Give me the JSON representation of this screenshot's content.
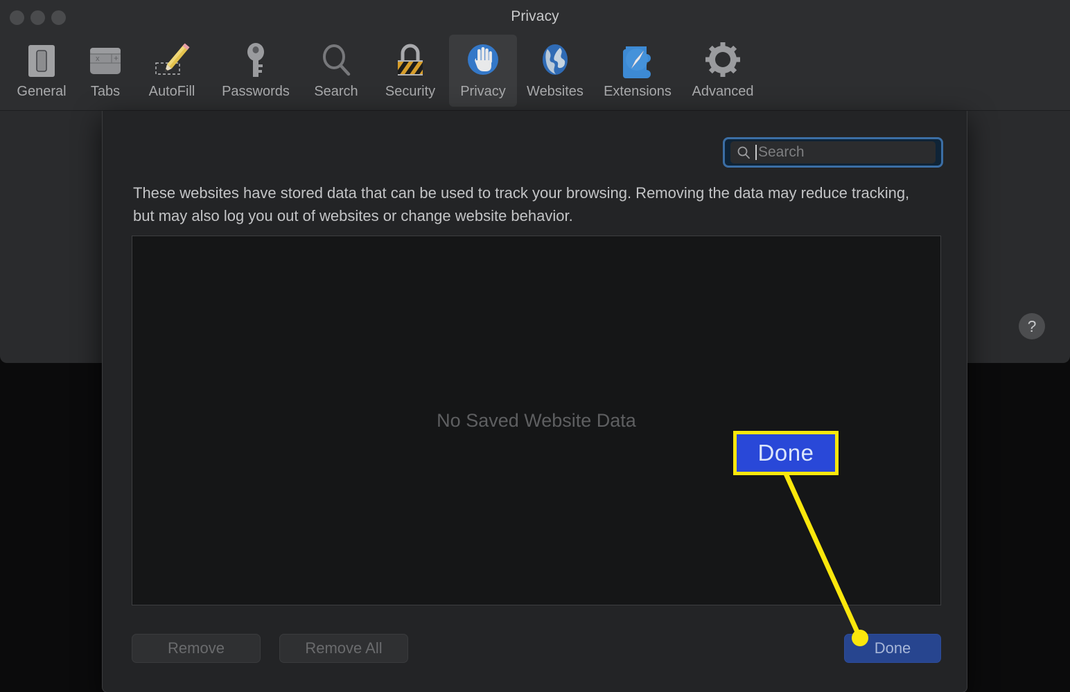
{
  "window": {
    "title": "Privacy",
    "traffic_lights": [
      "close-button",
      "minimize-button",
      "zoom-button"
    ]
  },
  "toolbar": {
    "items": [
      {
        "label": "General",
        "icon": "general-icon",
        "selected": false
      },
      {
        "label": "Tabs",
        "icon": "tabs-icon",
        "selected": false
      },
      {
        "label": "AutoFill",
        "icon": "autofill-icon",
        "selected": false
      },
      {
        "label": "Passwords",
        "icon": "passwords-icon",
        "selected": false
      },
      {
        "label": "Search",
        "icon": "search-tab-icon",
        "selected": false
      },
      {
        "label": "Security",
        "icon": "security-icon",
        "selected": false
      },
      {
        "label": "Privacy",
        "icon": "privacy-icon",
        "selected": true
      },
      {
        "label": "Websites",
        "icon": "websites-icon",
        "selected": false
      },
      {
        "label": "Extensions",
        "icon": "extensions-icon",
        "selected": false
      },
      {
        "label": "Advanced",
        "icon": "advanced-icon",
        "selected": false
      }
    ]
  },
  "sheet": {
    "search": {
      "value": "",
      "placeholder": "Search",
      "focused": true
    },
    "description": "These websites have stored data that can be used to track your browsing. Removing the data may reduce tracking, but may also log you out of websites or change website behavior.",
    "list": {
      "empty_message": "No Saved Website Data",
      "rows": []
    },
    "buttons": {
      "remove": {
        "label": "Remove",
        "enabled": false
      },
      "remove_all": {
        "label": "Remove All",
        "enabled": false
      },
      "done": {
        "label": "Done",
        "enabled": true
      }
    }
  },
  "help": {
    "label": "?"
  },
  "annotation": {
    "callout_label": "Done",
    "highlight_color": "#fbe70c",
    "button_color": "#2948d8"
  }
}
